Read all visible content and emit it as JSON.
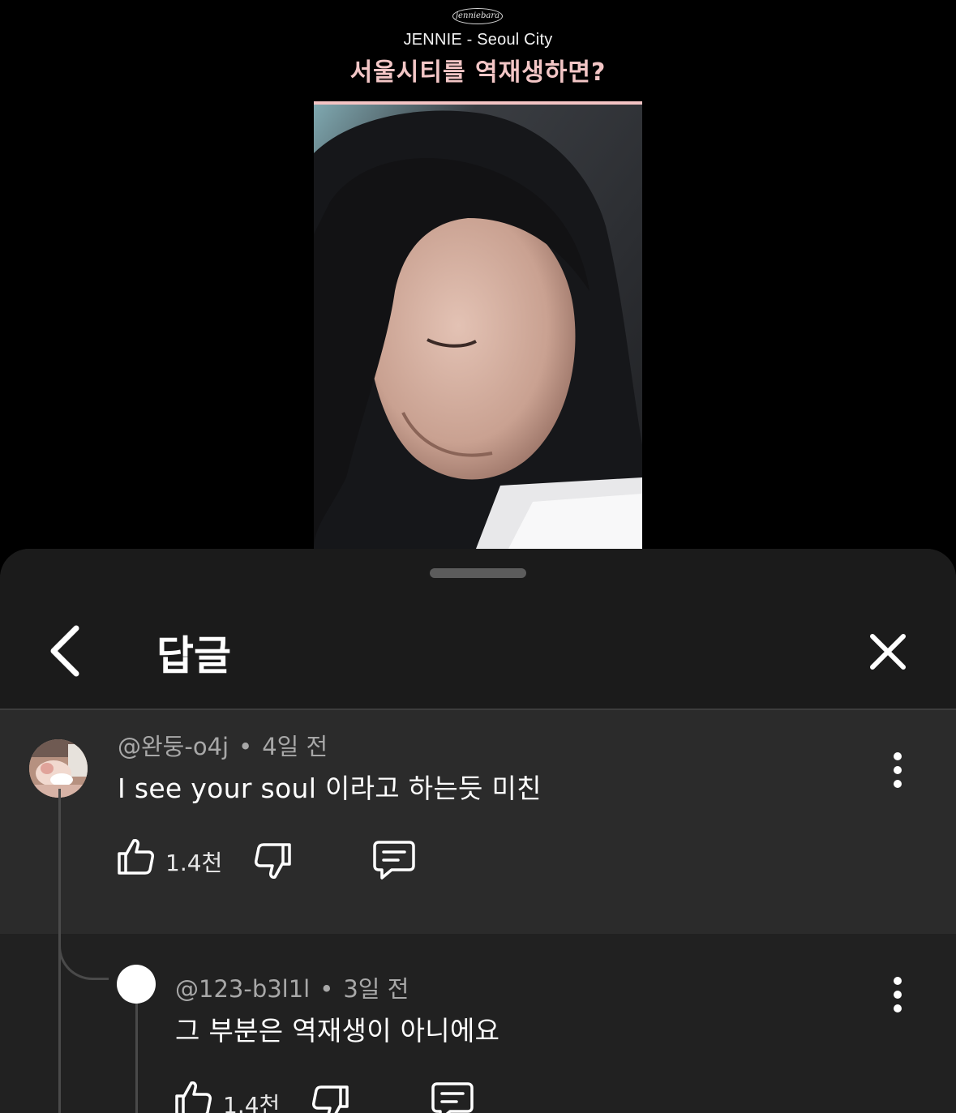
{
  "video": {
    "channel_logo_text": "jenniebara",
    "title": "JENNIE - Seoul City",
    "subtitle": "서울시티를 역재생하면?"
  },
  "sheet": {
    "title": "답글",
    "icons": {
      "back": "chevron-left-icon",
      "close": "close-icon",
      "more": "more-vertical-icon"
    }
  },
  "comments": [
    {
      "author": "@완둥-o4j",
      "time": "4일 전",
      "text": "I see your soul 이라고 하는듯 미친",
      "likes": "1.4천"
    },
    {
      "author": "@123-b3l1l",
      "time": "3일 전",
      "text": "그 부분은 역재생이 아니에요",
      "likes": "1.4천"
    }
  ],
  "separator": "•",
  "colors": {
    "subtitle": "#f3c6c6",
    "sheet_background": "#212121",
    "highlighted_comment": "#2b2b2b",
    "meta_text": "#a8a8a8"
  }
}
